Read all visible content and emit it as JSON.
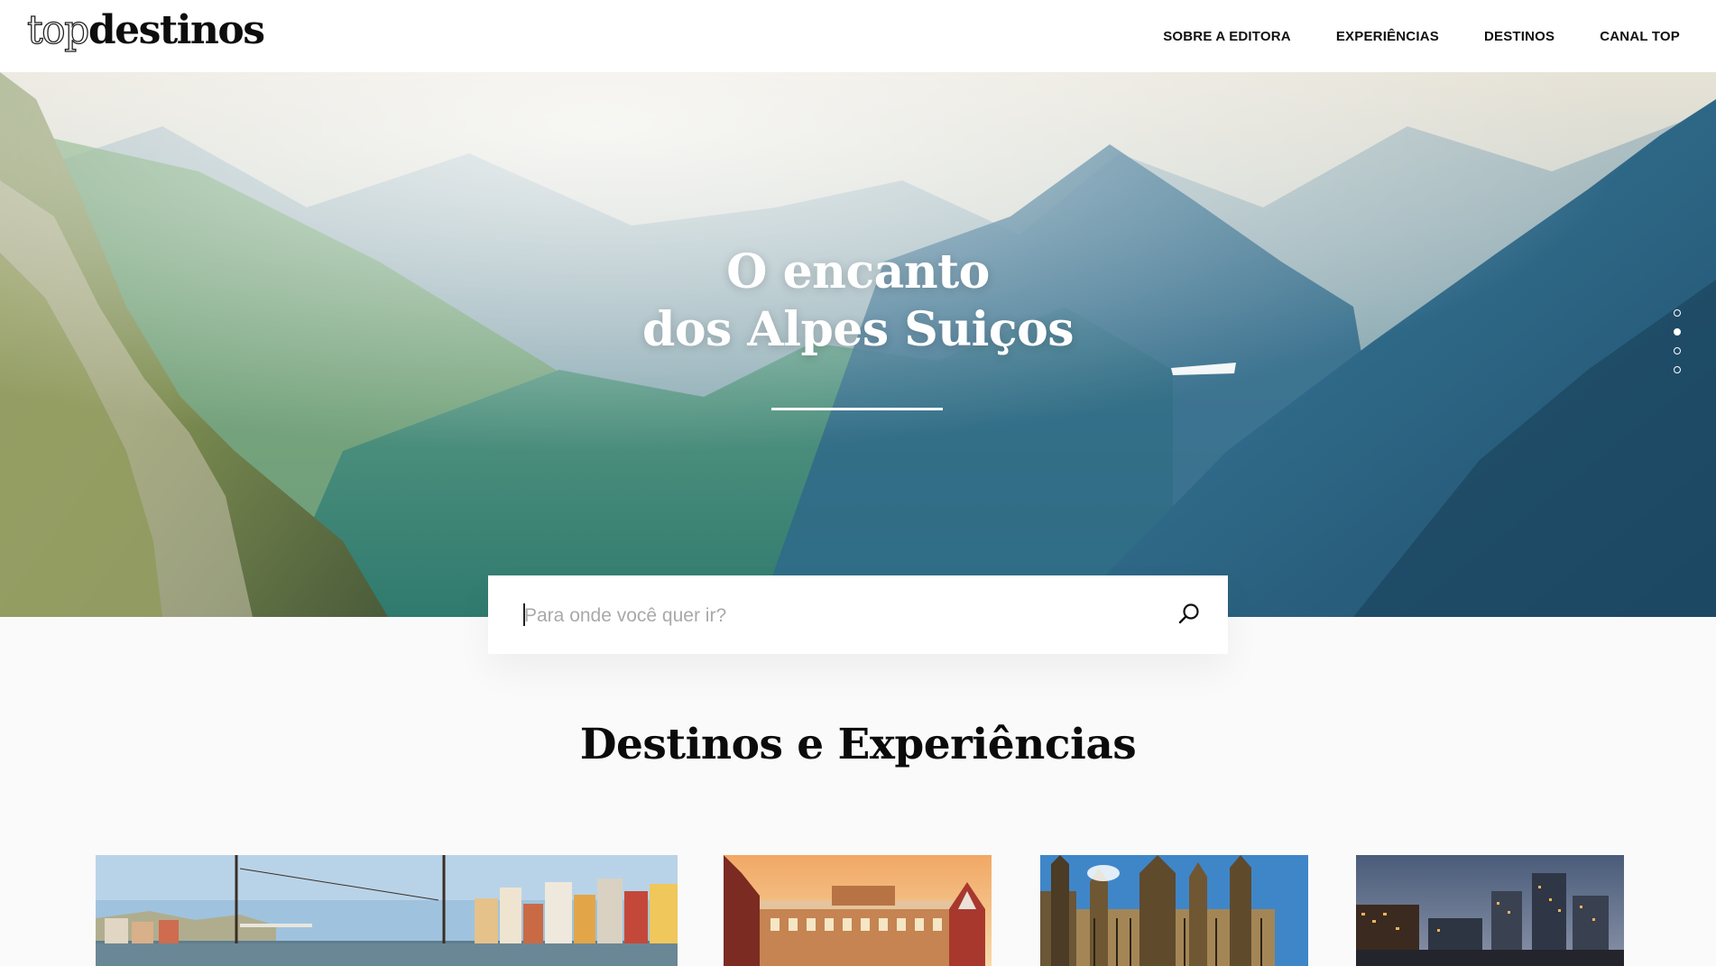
{
  "header": {
    "logo": {
      "light": "top",
      "bold": "destinos"
    },
    "nav": [
      {
        "label": "SOBRE A EDITORA"
      },
      {
        "label": "EXPERIÊNCIAS"
      },
      {
        "label": "DESTINOS"
      },
      {
        "label": "CANAL TOP"
      }
    ]
  },
  "hero": {
    "title_line1": "O encanto",
    "title_line2": "dos Alpes Suiços",
    "slides": {
      "count": 4,
      "active_index": 1
    }
  },
  "search": {
    "placeholder": "Para onde você quer ir?",
    "value": ""
  },
  "section": {
    "title": "Destinos e Experiências"
  },
  "cards": [
    {
      "name": "porto-riverside"
    },
    {
      "name": "moscow-gum"
    },
    {
      "name": "london-westminster"
    },
    {
      "name": "london-canary-wharf"
    }
  ],
  "colors": {
    "text": "#0b0b0b",
    "background": "#fafafa",
    "header_bg": "#ffffff",
    "hero_text": "#ffffff"
  }
}
